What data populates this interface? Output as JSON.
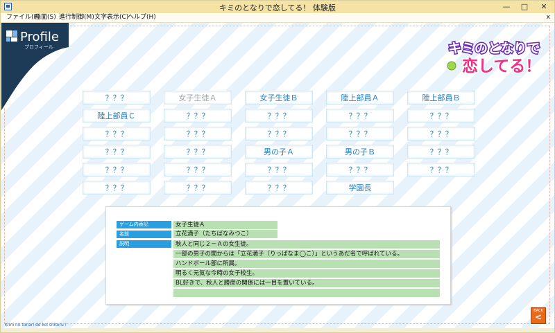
{
  "window": {
    "title": "キミのとなりで恋してる！ 体験版",
    "minimize": "—",
    "maximize": "□",
    "close": "✕"
  },
  "menu": {
    "items": [
      "ファイル(F)",
      "画面(S)",
      "進行制御(M)",
      "文字表示(C)",
      "ヘルプ(H)"
    ],
    "close": "x"
  },
  "header": {
    "title": "Profile",
    "subtitle": "プロフィール"
  },
  "logo": {
    "line1": "キミのとなりで",
    "line2": "恋してる！"
  },
  "characters": [
    {
      "label": "？？？",
      "dim": false
    },
    {
      "label": "女子生徒Ａ",
      "dim": true
    },
    {
      "label": "女子生徒Ｂ",
      "dim": false
    },
    {
      "label": "陸上部員Ａ",
      "dim": false
    },
    {
      "label": "陸上部員Ｂ",
      "dim": false
    },
    {
      "label": "陸上部員Ｃ",
      "dim": false
    },
    {
      "label": "？？？",
      "dim": false
    },
    {
      "label": "？？？",
      "dim": false
    },
    {
      "label": "？？？",
      "dim": false
    },
    {
      "label": "？？？",
      "dim": false
    },
    {
      "label": "？？？",
      "dim": false
    },
    {
      "label": "？？？",
      "dim": false
    },
    {
      "label": "？？？",
      "dim": false
    },
    {
      "label": "？？？",
      "dim": false
    },
    {
      "label": "？？？",
      "dim": false
    },
    {
      "label": "？？？",
      "dim": false
    },
    {
      "label": "？？？",
      "dim": false
    },
    {
      "label": "男の子Ａ",
      "dim": false
    },
    {
      "label": "男の子Ｂ",
      "dim": false
    },
    {
      "label": "？？？",
      "dim": false
    },
    {
      "label": "？？？",
      "dim": false
    },
    {
      "label": "？？？",
      "dim": false
    },
    {
      "label": "？？？",
      "dim": false
    },
    {
      "label": "？？？",
      "dim": false
    },
    {
      "label": "？？？",
      "dim": false
    },
    {
      "label": "？？？",
      "dim": false
    },
    {
      "label": "？？？",
      "dim": false
    },
    {
      "label": "？？？",
      "dim": false
    },
    {
      "label": "学園長",
      "dim": false
    }
  ],
  "profile": {
    "labels": {
      "in_game": "ゲーム内表記",
      "name": "名前",
      "description": "説明"
    },
    "in_game_value": "女子生徒Ａ",
    "name_value": "立花満子（たちばなみつこ）",
    "description_lines": [
      "秋人と同じ２－Ａの女生徒。",
      "一部の男子の間からは「立花満子（りっぱなま◯こ）」というあだ名で呼ばれている。",
      "ハンドボール部に所属。",
      "明るく元気な今時の女子校生。",
      "BL好きで、秋人と勝彦の関係には一目を置いている。",
      ""
    ]
  },
  "footer": {
    "text": "Kimi no tonari de koi shiteru !"
  },
  "back_button": {
    "label": "BACK",
    "arrow": "<"
  },
  "colors": {
    "header_navy": "#1d3a56",
    "label_blue": "#2a9fe0",
    "value_green": "#b9e0b3",
    "button_text": "#1e7fc9",
    "back_orange": "#ea6a1b"
  }
}
